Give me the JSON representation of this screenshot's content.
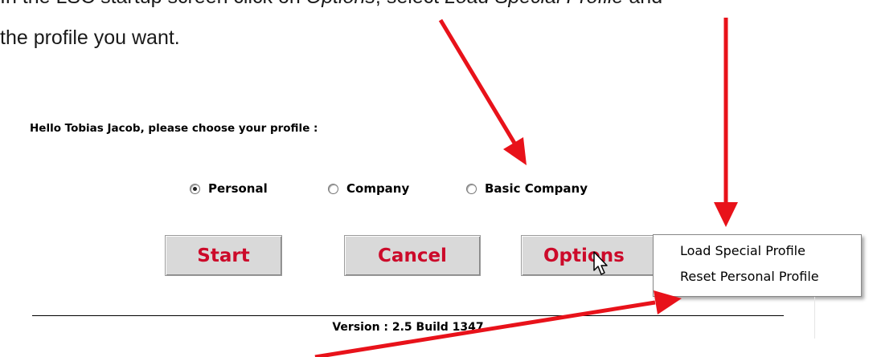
{
  "doc": {
    "line1_a": "In the LSC startup screen click on ",
    "line1_em1": "Options",
    "line1_b": ", select ",
    "line1_em2": "Load Special Profile",
    "line1_c": " and",
    "line2": "the profile you want."
  },
  "dialog": {
    "greeting": "Hello Tobias Jacob, please choose your profile :",
    "profiles": [
      {
        "label": "Personal",
        "selected": true
      },
      {
        "label": "Company",
        "selected": false
      },
      {
        "label": "Basic Company",
        "selected": false
      }
    ],
    "buttons": {
      "start": "Start",
      "cancel": "Cancel",
      "options": "Options"
    },
    "options_menu": [
      "Load Special Profile",
      "Reset Personal Profile"
    ],
    "version": "Version : 2.5 Build 1347"
  },
  "colors": {
    "button_text": "#cc0a2a",
    "arrow": "#e8121a",
    "button_face": "#d9d9d9"
  },
  "icons": [
    "radio-icon",
    "mouse-cursor-icon",
    "annotation-arrow-icon"
  ]
}
